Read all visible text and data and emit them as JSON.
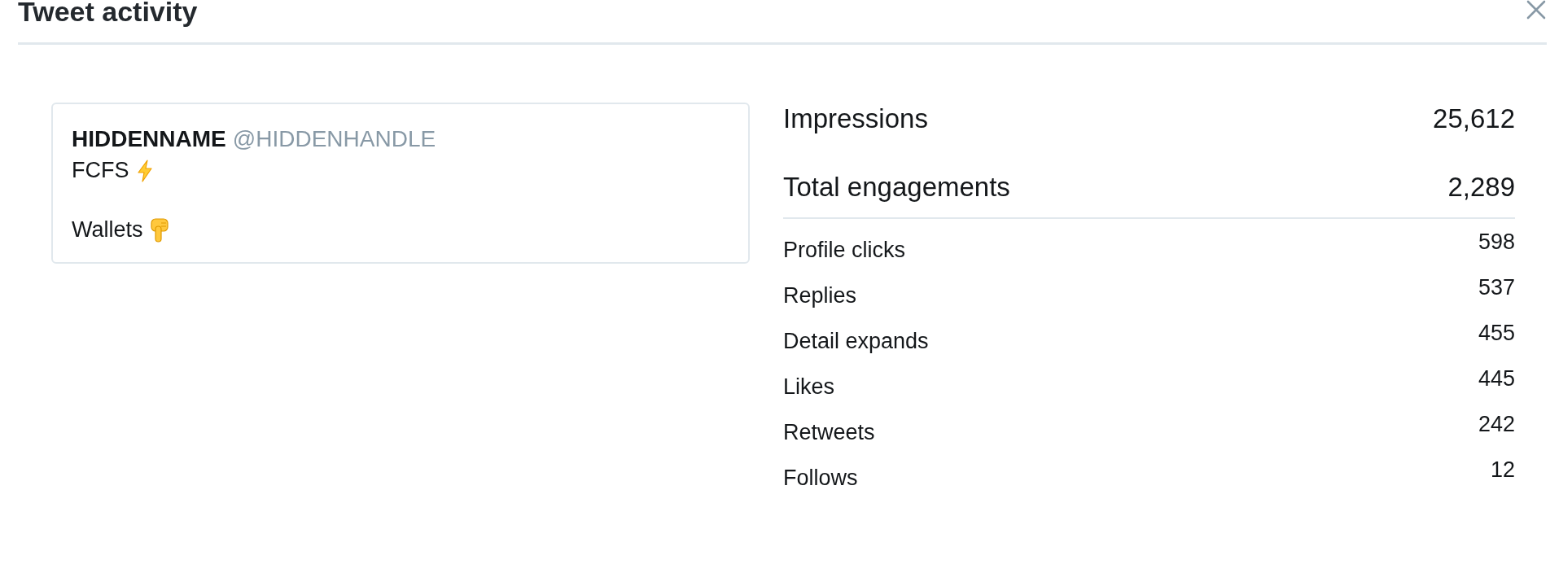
{
  "dialog": {
    "title": "Tweet activity"
  },
  "tweet": {
    "name": "HIDDENNAME",
    "handle": "@HIDDENHANDLE",
    "paragraphs": [
      {
        "text": "FCFS",
        "kind": "bolt"
      },
      {
        "text": "Wallets",
        "kind": "pointing"
      }
    ]
  },
  "summary": [
    {
      "label": "Impressions",
      "value": "25,612"
    },
    {
      "label": "Total engagements",
      "value": "2,289"
    }
  ],
  "engagements": [
    {
      "label": "Profile clicks",
      "value": "598"
    },
    {
      "label": "Replies",
      "value": "537"
    },
    {
      "label": "Detail expands",
      "value": "455"
    },
    {
      "label": "Likes",
      "value": "445"
    },
    {
      "label": "Retweets",
      "value": "242"
    },
    {
      "label": "Follows",
      "value": "12"
    }
  ]
}
